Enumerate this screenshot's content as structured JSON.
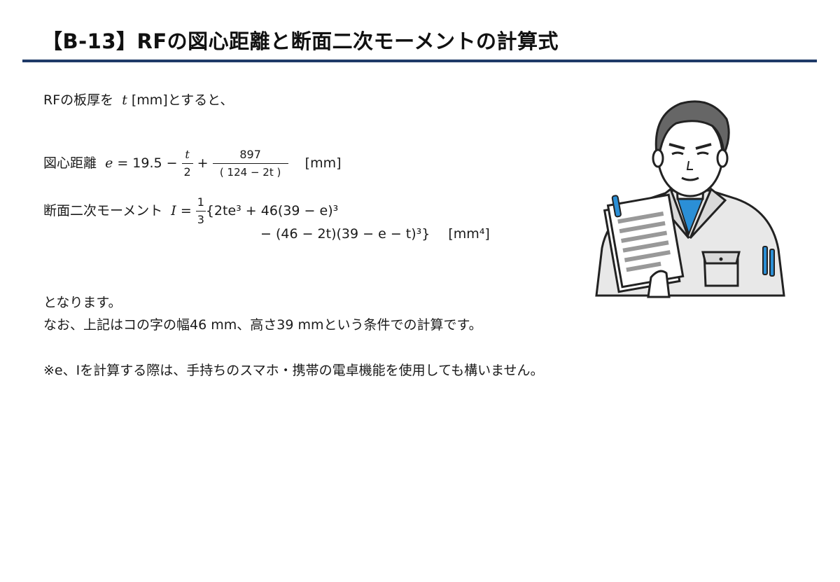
{
  "title": "【B-13】RFの図心距離と断面二次モーメントの計算式",
  "intro": {
    "pre": "RFの板厚を",
    "var": "t",
    "unit": " [mm]とすると、"
  },
  "centroid": {
    "label": "図心距離",
    "var": "e",
    "eq": " = 19.5 − ",
    "frac1_num": "t",
    "frac1_den": "2",
    "plus": " + ",
    "frac2_num": "897",
    "frac2_den": "( 124 − 2t )",
    "unit": "[mm]"
  },
  "inertia": {
    "label": "断面二次モーメント",
    "var": "I",
    "eq": " = ",
    "frac_num": "1",
    "frac_den": "3",
    "line1": "{2te³ + 46(39 − e)³",
    "line2": "− (46 − 2t)(39 − e − t)³}",
    "unit": "[mm⁴]"
  },
  "outro1": "となります。",
  "outro2": "なお、上記はコの字の幅46 mm、高さ39 mmという条件での計算です。",
  "note": "※e、Iを計算する際は、手持ちのスマホ・携帯の電卓機能を使用しても構いません。",
  "colors": {
    "rule": "#1f3a68",
    "accent": "#2b8fd6"
  }
}
